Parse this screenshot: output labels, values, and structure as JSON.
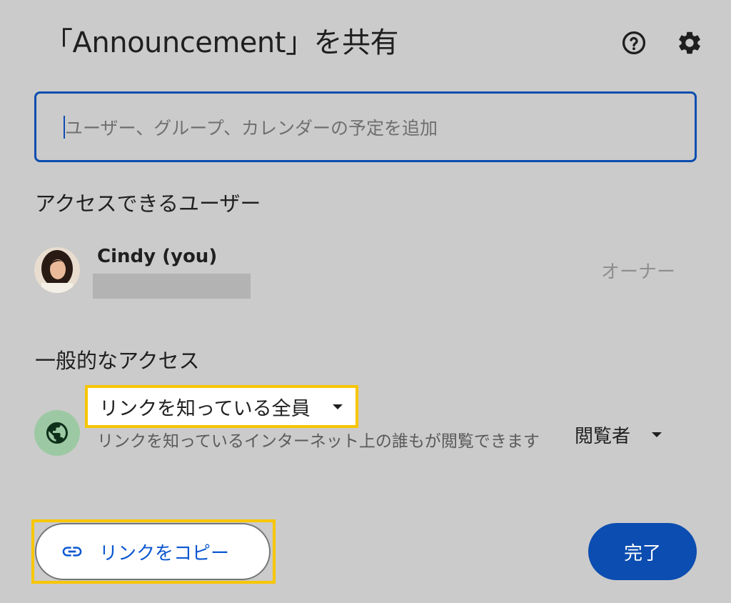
{
  "dialog": {
    "title": "「Announcement」を共有",
    "help_icon": "help-circle-icon",
    "settings_icon": "gear-icon"
  },
  "search": {
    "placeholder": "ユーザー、グループ、カレンダーの予定を追加",
    "value": ""
  },
  "people_section": {
    "heading": "アクセスできるユーザー",
    "users": [
      {
        "name": "Cindy (you)",
        "role": "オーナー"
      }
    ]
  },
  "general_access": {
    "heading": "一般的なアクセス",
    "icon": "globe-icon",
    "selected": "リンクを知っている全員",
    "description": "リンクを知っているインターネット上の誰もが閲覧できます",
    "role": "閲覧者"
  },
  "footer": {
    "copy_link_label": "リンクをコピー",
    "done_label": "完了"
  },
  "colors": {
    "background": "#cbcbcb",
    "primary": "#0b4db0",
    "highlight": "#f7c600",
    "globe_bg": "#9cc9a3"
  }
}
